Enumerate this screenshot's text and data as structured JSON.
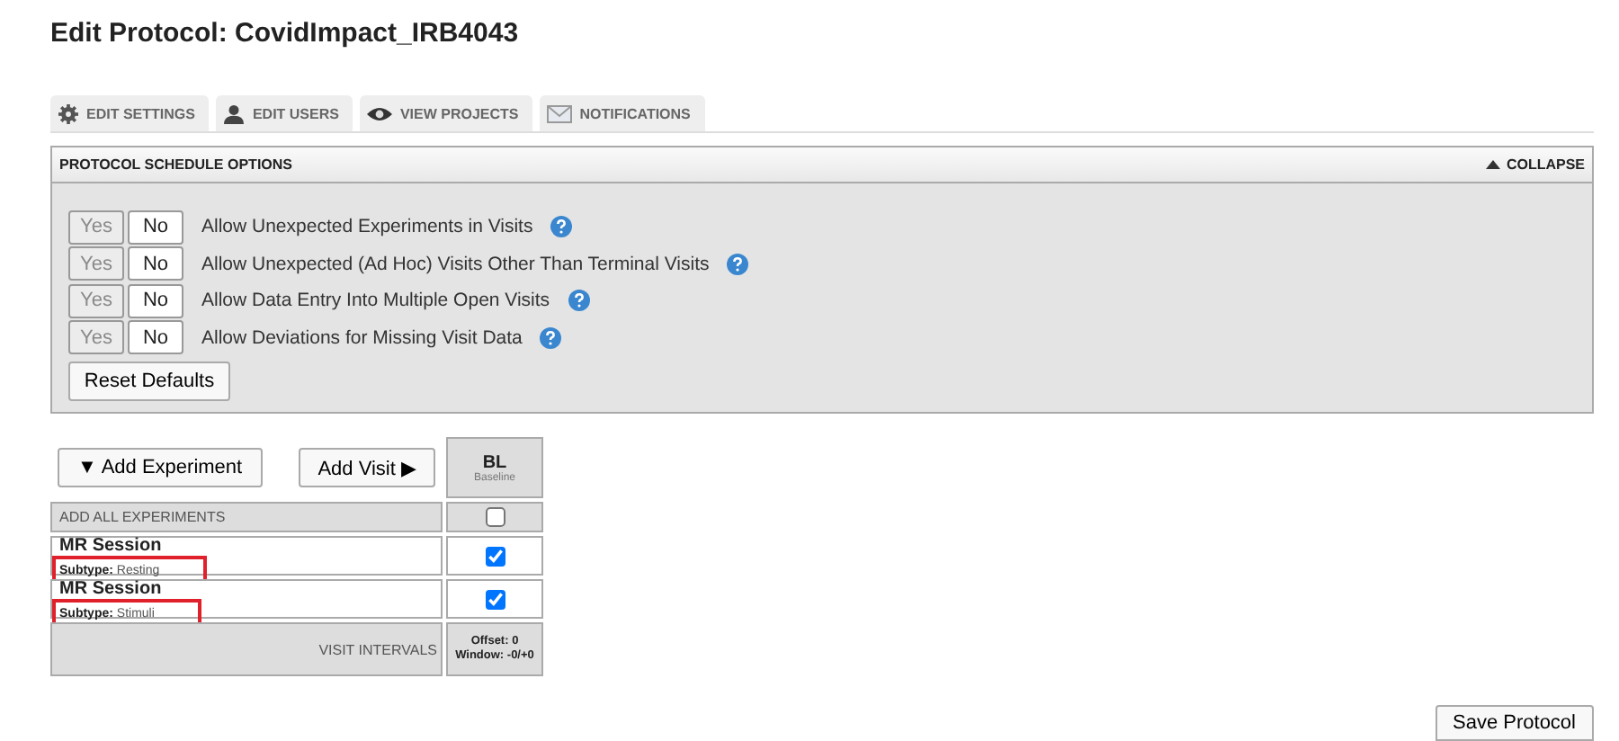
{
  "title": "Edit Protocol: CovidImpact_IRB4043",
  "tabs": [
    {
      "label": "EDIT SETTINGS",
      "kind": "gear"
    },
    {
      "label": "EDIT USERS",
      "kind": "user"
    },
    {
      "label": "VIEW PROJECTS",
      "kind": "eye"
    },
    {
      "label": "NOTIFICATIONS",
      "kind": "mail"
    }
  ],
  "panel": {
    "title": "PROTOCOL SCHEDULE OPTIONS",
    "collapse": "COLLAPSE",
    "options": [
      {
        "yes": {
          "label": "Yes",
          "selected": false
        },
        "no": {
          "label": "No",
          "selected": true
        },
        "label": "Allow Unexpected Experiments in Visits"
      },
      {
        "yes": {
          "label": "Yes",
          "selected": false
        },
        "no": {
          "label": "No",
          "selected": true
        },
        "label": "Allow Unexpected (Ad Hoc) Visits Other Than Terminal Visits"
      },
      {
        "yes": {
          "label": "Yes",
          "selected": false
        },
        "no": {
          "label": "No",
          "selected": true
        },
        "label": "Allow Data Entry Into Multiple Open Visits"
      },
      {
        "yes": {
          "label": "Yes",
          "selected": false
        },
        "no": {
          "label": "No",
          "selected": true
        },
        "label": "Allow Deviations for Missing Visit Data"
      }
    ],
    "reset": "Reset Defaults"
  },
  "schedule": {
    "add_experiment": "▼ Add Experiment",
    "add_visit": "Add Visit ▶",
    "visit": {
      "code": "BL",
      "name": "Baseline"
    },
    "add_all": {
      "label": "ADD ALL EXPERIMENTS",
      "checked": false
    },
    "experiments": [
      {
        "name": "MR Session",
        "subtype_label": "Subtype:",
        "subtype": "Resting",
        "checked": true,
        "highlighted": true
      },
      {
        "name": "MR Session",
        "subtype_label": "Subtype:",
        "subtype": "Stimuli",
        "checked": true,
        "highlighted": true
      }
    ],
    "intervals": {
      "label": "VISIT INTERVALS",
      "offset": "Offset: 0",
      "window": "Window: -0/+0"
    }
  },
  "save": "Save Protocol"
}
